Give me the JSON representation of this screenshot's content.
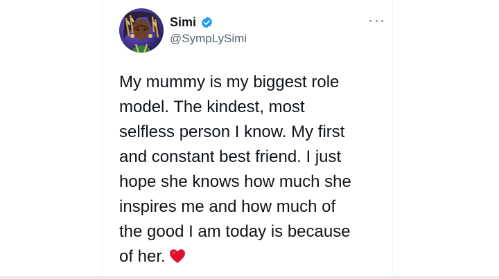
{
  "tweet": {
    "author": {
      "name": "Simi",
      "handle": "@SympLySimi",
      "verified": true,
      "avatar_icon": "profile-photo-avatar"
    },
    "more_icon": "ellipsis-icon",
    "text_lines": [
      "My mummy is my biggest role",
      "model. The kindest, most",
      "selfless person I know. My first",
      "and constant best friend. I just",
      "hope she knows how much she",
      "inspires me and how much of",
      "the good I am today is because",
      "of her."
    ],
    "emoji": "red-heart-icon"
  },
  "colors": {
    "verified_blue": "#1d9bf0",
    "text": "#0f1419",
    "secondary_text": "#536471",
    "heart_red": "#e0102a"
  }
}
